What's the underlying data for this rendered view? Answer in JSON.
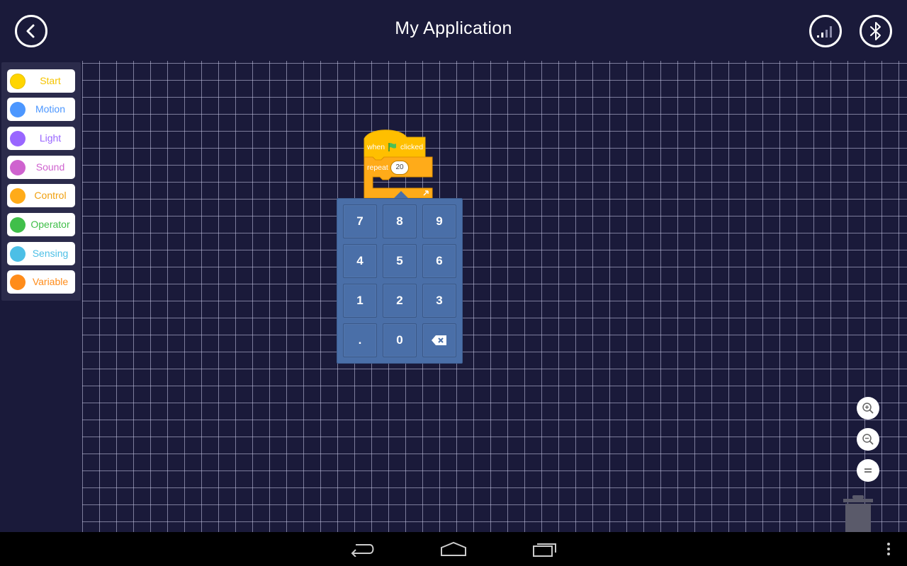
{
  "header": {
    "title": "My Application",
    "back_icon": "chevron-left-icon",
    "signal_icon": "signal-strength-icon",
    "bluetooth_icon": "bluetooth-icon"
  },
  "sidebar": {
    "categories": [
      {
        "label": "Start",
        "color": "#ffd500",
        "text_color": "#f5c400"
      },
      {
        "label": "Motion",
        "color": "#4c97ff",
        "text_color": "#4c97ff"
      },
      {
        "label": "Light",
        "color": "#9966ff",
        "text_color": "#9966ff"
      },
      {
        "label": "Sound",
        "color": "#cf63cf",
        "text_color": "#cf63cf"
      },
      {
        "label": "Control",
        "color": "#ffab19",
        "text_color": "#f0a010"
      },
      {
        "label": "Operator",
        "color": "#40bf4a",
        "text_color": "#40bf4a"
      },
      {
        "label": "Sensing",
        "color": "#4cbfe6",
        "text_color": "#4cbfe6"
      },
      {
        "label": "Variable",
        "color": "#ff8c1a",
        "text_color": "#ff8c1a"
      }
    ]
  },
  "blocks": {
    "hat": {
      "word1": "when",
      "word2": "clicked",
      "icon": "green-flag-icon",
      "color": "#ffbf00"
    },
    "repeat": {
      "label": "repeat",
      "value": "20",
      "color": "#ffab19",
      "loop_icon": "loop-arrow-icon"
    }
  },
  "keypad": {
    "keys": [
      "7",
      "8",
      "9",
      "4",
      "5",
      "6",
      "1",
      "2",
      "3",
      ".",
      "0"
    ],
    "backspace_icon": "backspace-icon",
    "color": "#4a6fa8"
  },
  "zoom": {
    "zoom_in_icon": "zoom-in-icon",
    "zoom_out_icon": "zoom-out-icon",
    "reset_icon": "zoom-reset-icon",
    "trash_icon": "trash-icon"
  },
  "navbar": {
    "back_icon": "nav-back-icon",
    "home_icon": "nav-home-icon",
    "recents_icon": "nav-recents-icon",
    "menu_icon": "overflow-menu-icon"
  }
}
